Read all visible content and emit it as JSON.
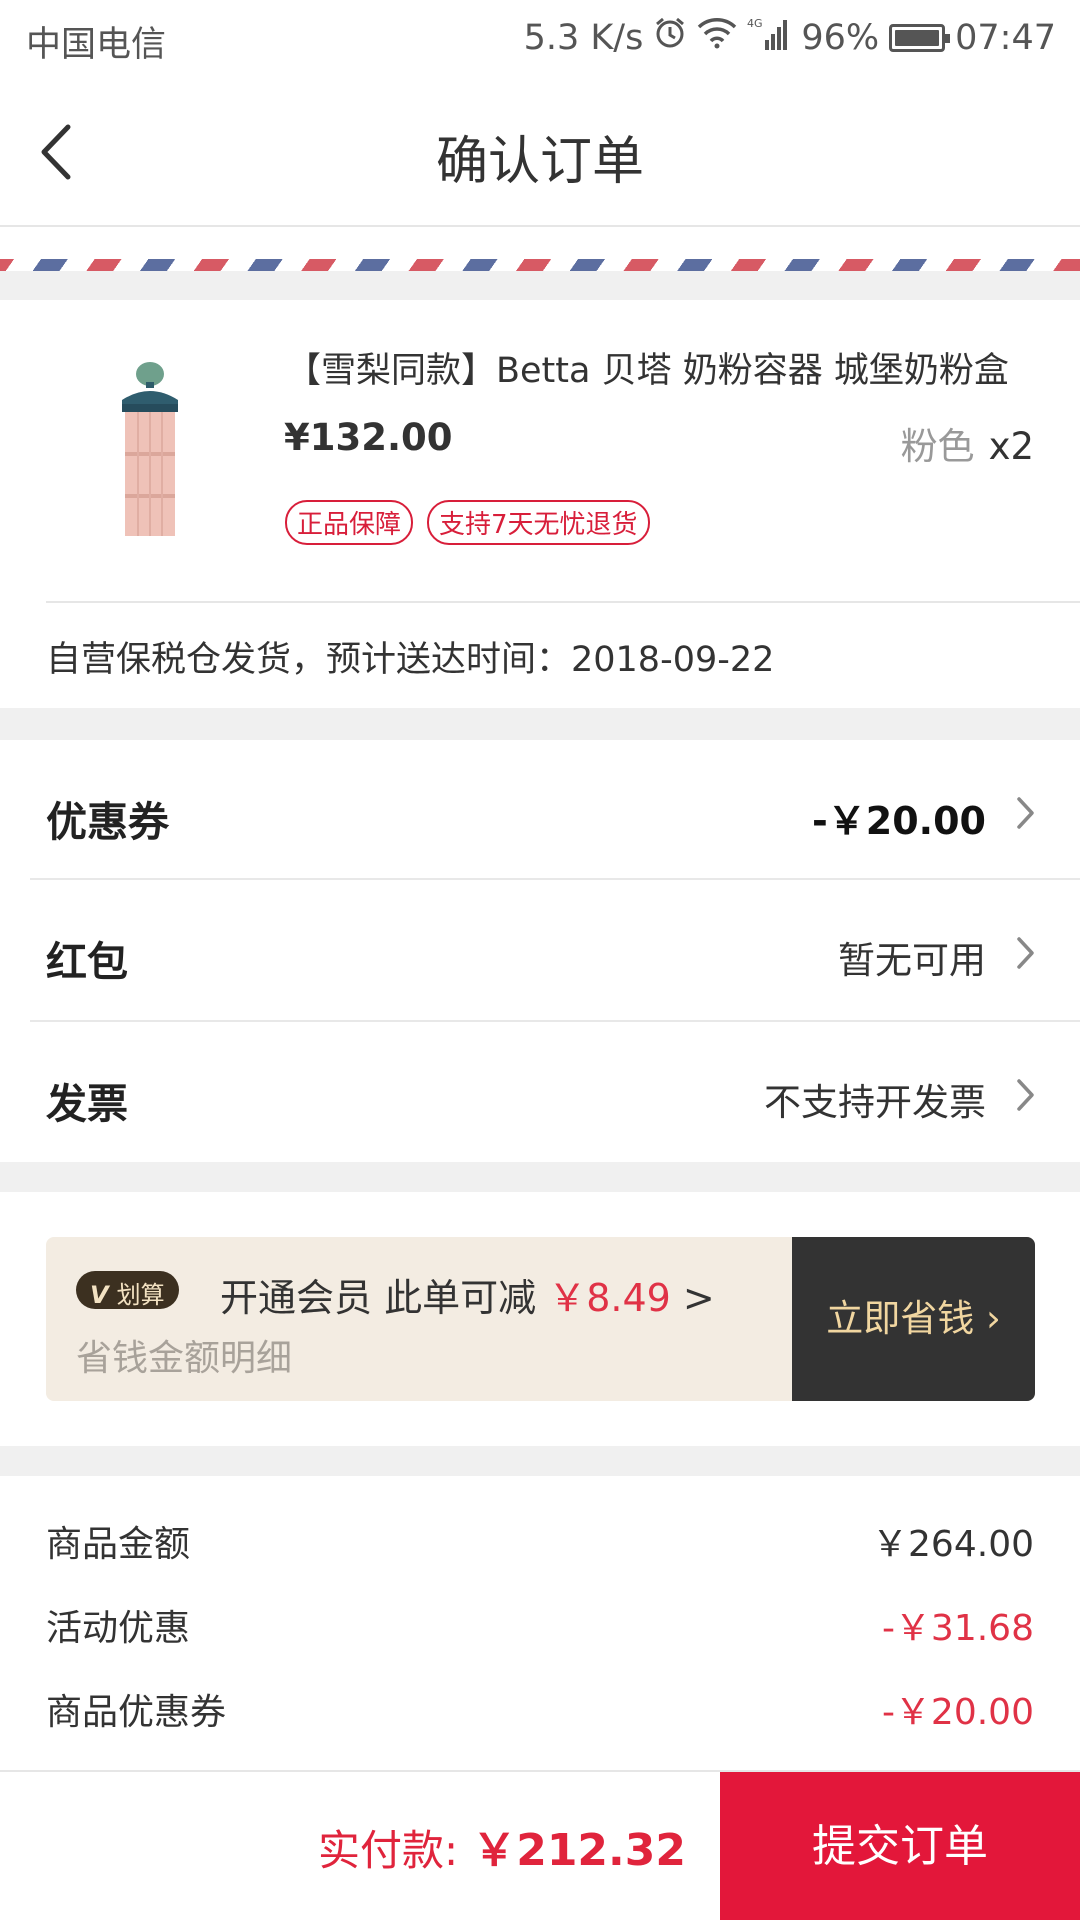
{
  "status_bar": {
    "carrier": "中国电信",
    "speed": "5.3 K/s",
    "network": "4G",
    "battery": "96%",
    "time": "07:47"
  },
  "nav": {
    "title": "确认订单"
  },
  "product": {
    "title": "【雪梨同款】Betta 贝塔 奶粉容器 城堡奶粉盒",
    "price": "¥132.00",
    "color": "粉色",
    "quantity": "x2",
    "tags": [
      "正品保障",
      "支持7天无忧退货"
    ]
  },
  "shipping": {
    "text": "自营保税仓发货，预计送达时间：2018-09-22"
  },
  "options": [
    {
      "label": "优惠券",
      "value": "-￥20.00"
    },
    {
      "label": "红包",
      "value": "暂无可用"
    },
    {
      "label": "发票",
      "value": "不支持开发票"
    }
  ],
  "vip": {
    "badge_mark": "V",
    "badge_text": "划算",
    "main_text": "开通会员 此单可减",
    "amount": "￥8.49",
    "arrow": ">",
    "sub_text": "省钱金额明细",
    "button_label": "立即省钱",
    "button_arrow": "›"
  },
  "summary": [
    {
      "label": "商品金额",
      "value": "￥264.00"
    },
    {
      "label": "活动优惠",
      "value": "-￥31.68"
    },
    {
      "label": "商品优惠券",
      "value": "-￥20.00"
    }
  ],
  "footer": {
    "pay_label": "实付款:",
    "pay_amount": "￥212.32",
    "submit_label": "提交订单"
  },
  "colors": {
    "accent_red": "#e3173a",
    "vip_bg": "#f3ece2",
    "vip_button": "#333333"
  }
}
